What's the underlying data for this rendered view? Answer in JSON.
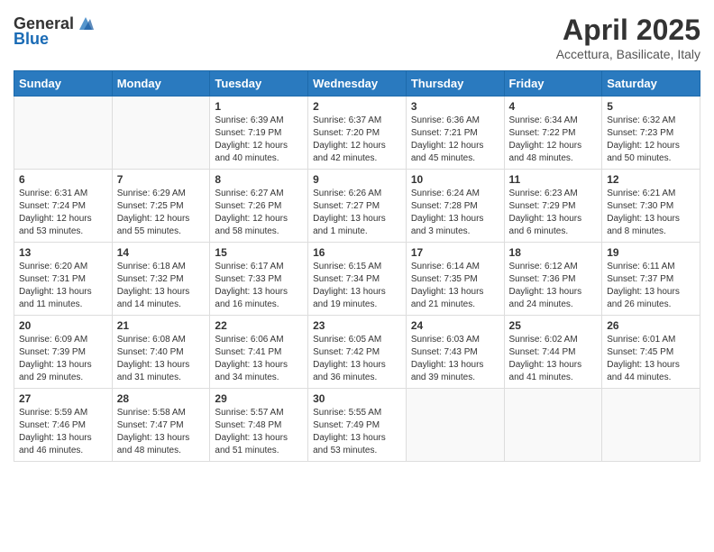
{
  "header": {
    "logo_general": "General",
    "logo_blue": "Blue",
    "month": "April 2025",
    "location": "Accettura, Basilicate, Italy"
  },
  "days_of_week": [
    "Sunday",
    "Monday",
    "Tuesday",
    "Wednesday",
    "Thursday",
    "Friday",
    "Saturday"
  ],
  "weeks": [
    [
      {
        "day": "",
        "sunrise": "",
        "sunset": "",
        "daylight": "",
        "empty": true
      },
      {
        "day": "",
        "sunrise": "",
        "sunset": "",
        "daylight": "",
        "empty": true
      },
      {
        "day": "1",
        "sunrise": "Sunrise: 6:39 AM",
        "sunset": "Sunset: 7:19 PM",
        "daylight": "Daylight: 12 hours and 40 minutes."
      },
      {
        "day": "2",
        "sunrise": "Sunrise: 6:37 AM",
        "sunset": "Sunset: 7:20 PM",
        "daylight": "Daylight: 12 hours and 42 minutes."
      },
      {
        "day": "3",
        "sunrise": "Sunrise: 6:36 AM",
        "sunset": "Sunset: 7:21 PM",
        "daylight": "Daylight: 12 hours and 45 minutes."
      },
      {
        "day": "4",
        "sunrise": "Sunrise: 6:34 AM",
        "sunset": "Sunset: 7:22 PM",
        "daylight": "Daylight: 12 hours and 48 minutes."
      },
      {
        "day": "5",
        "sunrise": "Sunrise: 6:32 AM",
        "sunset": "Sunset: 7:23 PM",
        "daylight": "Daylight: 12 hours and 50 minutes."
      }
    ],
    [
      {
        "day": "6",
        "sunrise": "Sunrise: 6:31 AM",
        "sunset": "Sunset: 7:24 PM",
        "daylight": "Daylight: 12 hours and 53 minutes."
      },
      {
        "day": "7",
        "sunrise": "Sunrise: 6:29 AM",
        "sunset": "Sunset: 7:25 PM",
        "daylight": "Daylight: 12 hours and 55 minutes."
      },
      {
        "day": "8",
        "sunrise": "Sunrise: 6:27 AM",
        "sunset": "Sunset: 7:26 PM",
        "daylight": "Daylight: 12 hours and 58 minutes."
      },
      {
        "day": "9",
        "sunrise": "Sunrise: 6:26 AM",
        "sunset": "Sunset: 7:27 PM",
        "daylight": "Daylight: 13 hours and 1 minute."
      },
      {
        "day": "10",
        "sunrise": "Sunrise: 6:24 AM",
        "sunset": "Sunset: 7:28 PM",
        "daylight": "Daylight: 13 hours and 3 minutes."
      },
      {
        "day": "11",
        "sunrise": "Sunrise: 6:23 AM",
        "sunset": "Sunset: 7:29 PM",
        "daylight": "Daylight: 13 hours and 6 minutes."
      },
      {
        "day": "12",
        "sunrise": "Sunrise: 6:21 AM",
        "sunset": "Sunset: 7:30 PM",
        "daylight": "Daylight: 13 hours and 8 minutes."
      }
    ],
    [
      {
        "day": "13",
        "sunrise": "Sunrise: 6:20 AM",
        "sunset": "Sunset: 7:31 PM",
        "daylight": "Daylight: 13 hours and 11 minutes."
      },
      {
        "day": "14",
        "sunrise": "Sunrise: 6:18 AM",
        "sunset": "Sunset: 7:32 PM",
        "daylight": "Daylight: 13 hours and 14 minutes."
      },
      {
        "day": "15",
        "sunrise": "Sunrise: 6:17 AM",
        "sunset": "Sunset: 7:33 PM",
        "daylight": "Daylight: 13 hours and 16 minutes."
      },
      {
        "day": "16",
        "sunrise": "Sunrise: 6:15 AM",
        "sunset": "Sunset: 7:34 PM",
        "daylight": "Daylight: 13 hours and 19 minutes."
      },
      {
        "day": "17",
        "sunrise": "Sunrise: 6:14 AM",
        "sunset": "Sunset: 7:35 PM",
        "daylight": "Daylight: 13 hours and 21 minutes."
      },
      {
        "day": "18",
        "sunrise": "Sunrise: 6:12 AM",
        "sunset": "Sunset: 7:36 PM",
        "daylight": "Daylight: 13 hours and 24 minutes."
      },
      {
        "day": "19",
        "sunrise": "Sunrise: 6:11 AM",
        "sunset": "Sunset: 7:37 PM",
        "daylight": "Daylight: 13 hours and 26 minutes."
      }
    ],
    [
      {
        "day": "20",
        "sunrise": "Sunrise: 6:09 AM",
        "sunset": "Sunset: 7:39 PM",
        "daylight": "Daylight: 13 hours and 29 minutes."
      },
      {
        "day": "21",
        "sunrise": "Sunrise: 6:08 AM",
        "sunset": "Sunset: 7:40 PM",
        "daylight": "Daylight: 13 hours and 31 minutes."
      },
      {
        "day": "22",
        "sunrise": "Sunrise: 6:06 AM",
        "sunset": "Sunset: 7:41 PM",
        "daylight": "Daylight: 13 hours and 34 minutes."
      },
      {
        "day": "23",
        "sunrise": "Sunrise: 6:05 AM",
        "sunset": "Sunset: 7:42 PM",
        "daylight": "Daylight: 13 hours and 36 minutes."
      },
      {
        "day": "24",
        "sunrise": "Sunrise: 6:03 AM",
        "sunset": "Sunset: 7:43 PM",
        "daylight": "Daylight: 13 hours and 39 minutes."
      },
      {
        "day": "25",
        "sunrise": "Sunrise: 6:02 AM",
        "sunset": "Sunset: 7:44 PM",
        "daylight": "Daylight: 13 hours and 41 minutes."
      },
      {
        "day": "26",
        "sunrise": "Sunrise: 6:01 AM",
        "sunset": "Sunset: 7:45 PM",
        "daylight": "Daylight: 13 hours and 44 minutes."
      }
    ],
    [
      {
        "day": "27",
        "sunrise": "Sunrise: 5:59 AM",
        "sunset": "Sunset: 7:46 PM",
        "daylight": "Daylight: 13 hours and 46 minutes."
      },
      {
        "day": "28",
        "sunrise": "Sunrise: 5:58 AM",
        "sunset": "Sunset: 7:47 PM",
        "daylight": "Daylight: 13 hours and 48 minutes."
      },
      {
        "day": "29",
        "sunrise": "Sunrise: 5:57 AM",
        "sunset": "Sunset: 7:48 PM",
        "daylight": "Daylight: 13 hours and 51 minutes."
      },
      {
        "day": "30",
        "sunrise": "Sunrise: 5:55 AM",
        "sunset": "Sunset: 7:49 PM",
        "daylight": "Daylight: 13 hours and 53 minutes."
      },
      {
        "day": "",
        "sunrise": "",
        "sunset": "",
        "daylight": "",
        "empty": true
      },
      {
        "day": "",
        "sunrise": "",
        "sunset": "",
        "daylight": "",
        "empty": true
      },
      {
        "day": "",
        "sunrise": "",
        "sunset": "",
        "daylight": "",
        "empty": true
      }
    ]
  ]
}
